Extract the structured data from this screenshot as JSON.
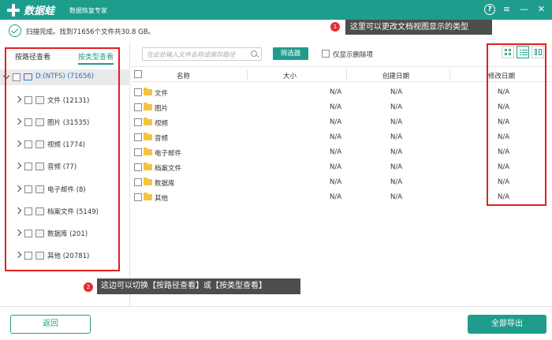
{
  "titlebar": {
    "app_name": "数据蛙",
    "app_subtitle": "数据恢复专家",
    "help": "?",
    "menu": "≡",
    "minimize": "—",
    "close": "✕"
  },
  "scan": {
    "status": "扫描完成。找到71656个文件共30.8 GB。"
  },
  "callouts": [
    {
      "num": "1",
      "text": "这里可以更改文档视图显示的类型"
    },
    {
      "num": "2",
      "text": "这边可以切换【按路径查看】或【按类型查看】"
    }
  ],
  "sidebar": {
    "tabs": [
      {
        "label": "按路径查看",
        "active": false
      },
      {
        "label": "按类型查看",
        "active": true
      }
    ],
    "root": {
      "label": "D:(NTFS) (71656)"
    },
    "items": [
      {
        "label": "文件 (12131)",
        "icon": "document-icon"
      },
      {
        "label": "图片 (31535)",
        "icon": "image-icon"
      },
      {
        "label": "视频 (1774)",
        "icon": "video-icon"
      },
      {
        "label": "音频 (77)",
        "icon": "audio-icon"
      },
      {
        "label": "电子邮件 (8)",
        "icon": "email-icon"
      },
      {
        "label": "档案文件 (5149)",
        "icon": "archive-icon"
      },
      {
        "label": "数据库 (201)",
        "icon": "database-icon"
      },
      {
        "label": "其他 (20781)",
        "icon": "other-icon"
      }
    ]
  },
  "filter": {
    "search_placeholder": "在此处输入文件名称或保存路径",
    "filter_button": "筛选器",
    "only_deleted": "仅显示删除项"
  },
  "table": {
    "columns": [
      "名称",
      "大小",
      "创建日期",
      "修改日期"
    ],
    "rows": [
      {
        "name": "文件",
        "size": "N/A",
        "created": "N/A",
        "modified": "N/A"
      },
      {
        "name": "图片",
        "size": "N/A",
        "created": "N/A",
        "modified": "N/A"
      },
      {
        "name": "视频",
        "size": "N/A",
        "created": "N/A",
        "modified": "N/A"
      },
      {
        "name": "音频",
        "size": "N/A",
        "created": "N/A",
        "modified": "N/A"
      },
      {
        "name": "电子邮件",
        "size": "N/A",
        "created": "N/A",
        "modified": "N/A"
      },
      {
        "name": "档案文件",
        "size": "N/A",
        "created": "N/A",
        "modified": "N/A"
      },
      {
        "name": "数据库",
        "size": "N/A",
        "created": "N/A",
        "modified": "N/A"
      },
      {
        "name": "其他",
        "size": "N/A",
        "created": "N/A",
        "modified": "N/A"
      }
    ]
  },
  "footer": {
    "back": "返回",
    "export_all": "全部导出"
  },
  "colors": {
    "brand": "#1f9d8c",
    "annotation_red": "#e02020",
    "callout_bg": "#4d4d4d"
  }
}
